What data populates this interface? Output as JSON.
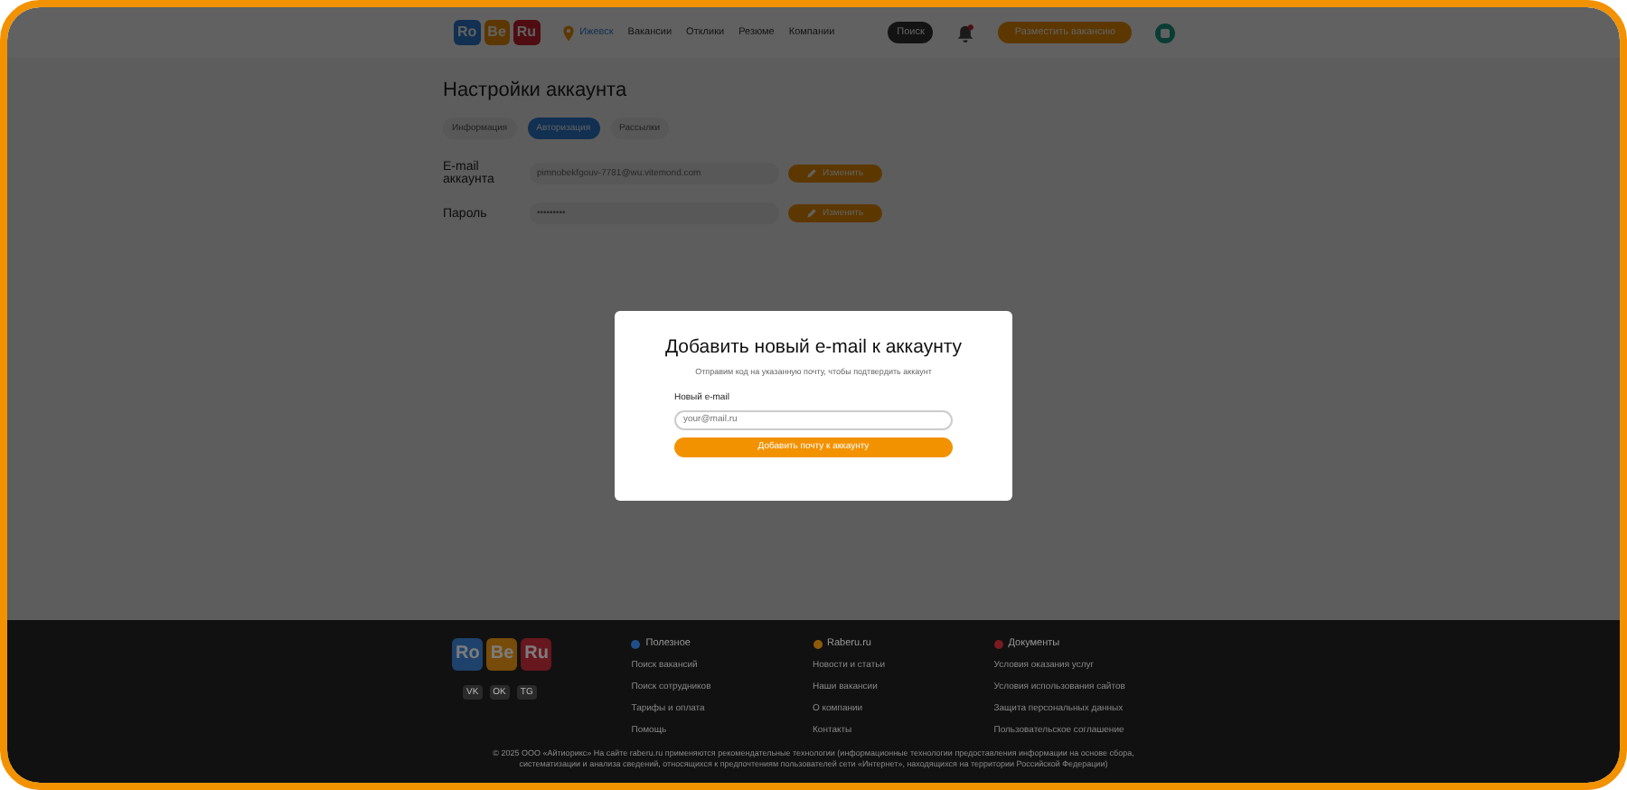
{
  "header": {
    "logo": [
      "Ro",
      "Be",
      "Ru"
    ],
    "city": "Ижевск",
    "nav": [
      {
        "label": "Вакансии"
      },
      {
        "label": "Отклики"
      },
      {
        "label": "Резюме"
      },
      {
        "label": "Компании"
      }
    ],
    "search_tooltip": "Поиск",
    "notification_dot": true,
    "post_button": "Разместить вакансию"
  },
  "settings": {
    "title": "Настройки аккаунта",
    "tabs": [
      {
        "label": "Информация",
        "selected": false
      },
      {
        "label": "Авторизация",
        "selected": true
      },
      {
        "label": "Рассылки",
        "selected": false
      }
    ],
    "fields": [
      {
        "label": "E-mail аккаунта",
        "value": "pimnobekfgouv-7781@wu.vitemond.com",
        "button": "Изменить"
      },
      {
        "label": "Пароль",
        "value": "•••••••••",
        "button": "Изменить"
      }
    ]
  },
  "modal": {
    "title": "Добавить новый e-mail к аккаунту",
    "subtitle": "Отправим код на указанную почту, чтобы подтвердить аккаунт",
    "field_label": "Новый e-mail",
    "placeholder": "your@mail.ru",
    "submit": "Добавить почту к аккаунту"
  },
  "footer": {
    "logo": [
      "Ro",
      "Be",
      "Ru"
    ],
    "socials": [
      "VK",
      "OK",
      "TG"
    ],
    "columns": [
      {
        "title": "Полезное",
        "color": "#1f4f86",
        "links": [
          "Поиск вакансий",
          "Поиск сотрудников",
          "Тарифы и оплата",
          "Помощь"
        ]
      },
      {
        "title": "Raberu.ru",
        "color": "#8f5a0a",
        "links": [
          "Новости и статьи",
          "Наши вакансии",
          "О компании",
          "Контакты"
        ]
      },
      {
        "title": "Документы",
        "color": "#7c1a22",
        "links": [
          "Условия оказания услуг",
          "Условия использования сайтов",
          "Защита персональных данных",
          "Пользовательское соглашение"
        ]
      }
    ],
    "copyright": "© 2025 ООО «Айтиорикс» На сайте raberu.ru применяются рекомендательные технологии (информационные технологии предоставления информации на основе сбора, систематизации и анализа сведений, относящихся к предпочтениям пользователей сети «Интернет», находящихся на территории Российской Федерации)"
  }
}
